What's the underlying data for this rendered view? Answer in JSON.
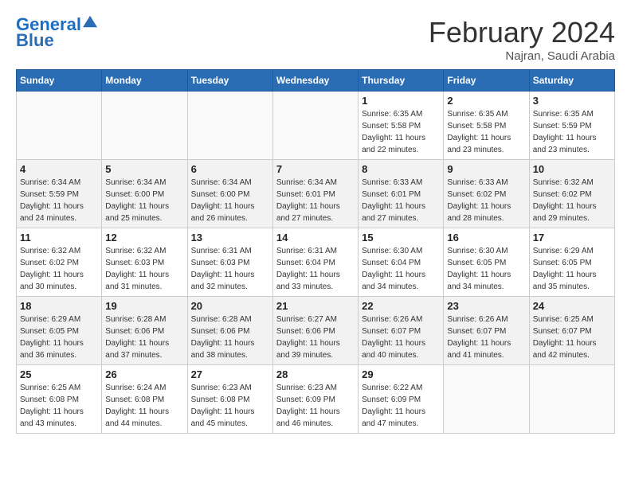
{
  "header": {
    "logo_line1": "General",
    "logo_line2": "Blue",
    "month": "February 2024",
    "location": "Najran, Saudi Arabia"
  },
  "days_of_week": [
    "Sunday",
    "Monday",
    "Tuesday",
    "Wednesday",
    "Thursday",
    "Friday",
    "Saturday"
  ],
  "weeks": [
    [
      {
        "day": "",
        "info": ""
      },
      {
        "day": "",
        "info": ""
      },
      {
        "day": "",
        "info": ""
      },
      {
        "day": "",
        "info": ""
      },
      {
        "day": "1",
        "info": "Sunrise: 6:35 AM\nSunset: 5:58 PM\nDaylight: 11 hours\nand 22 minutes."
      },
      {
        "day": "2",
        "info": "Sunrise: 6:35 AM\nSunset: 5:58 PM\nDaylight: 11 hours\nand 23 minutes."
      },
      {
        "day": "3",
        "info": "Sunrise: 6:35 AM\nSunset: 5:59 PM\nDaylight: 11 hours\nand 23 minutes."
      }
    ],
    [
      {
        "day": "4",
        "info": "Sunrise: 6:34 AM\nSunset: 5:59 PM\nDaylight: 11 hours\nand 24 minutes."
      },
      {
        "day": "5",
        "info": "Sunrise: 6:34 AM\nSunset: 6:00 PM\nDaylight: 11 hours\nand 25 minutes."
      },
      {
        "day": "6",
        "info": "Sunrise: 6:34 AM\nSunset: 6:00 PM\nDaylight: 11 hours\nand 26 minutes."
      },
      {
        "day": "7",
        "info": "Sunrise: 6:34 AM\nSunset: 6:01 PM\nDaylight: 11 hours\nand 27 minutes."
      },
      {
        "day": "8",
        "info": "Sunrise: 6:33 AM\nSunset: 6:01 PM\nDaylight: 11 hours\nand 27 minutes."
      },
      {
        "day": "9",
        "info": "Sunrise: 6:33 AM\nSunset: 6:02 PM\nDaylight: 11 hours\nand 28 minutes."
      },
      {
        "day": "10",
        "info": "Sunrise: 6:32 AM\nSunset: 6:02 PM\nDaylight: 11 hours\nand 29 minutes."
      }
    ],
    [
      {
        "day": "11",
        "info": "Sunrise: 6:32 AM\nSunset: 6:02 PM\nDaylight: 11 hours\nand 30 minutes."
      },
      {
        "day": "12",
        "info": "Sunrise: 6:32 AM\nSunset: 6:03 PM\nDaylight: 11 hours\nand 31 minutes."
      },
      {
        "day": "13",
        "info": "Sunrise: 6:31 AM\nSunset: 6:03 PM\nDaylight: 11 hours\nand 32 minutes."
      },
      {
        "day": "14",
        "info": "Sunrise: 6:31 AM\nSunset: 6:04 PM\nDaylight: 11 hours\nand 33 minutes."
      },
      {
        "day": "15",
        "info": "Sunrise: 6:30 AM\nSunset: 6:04 PM\nDaylight: 11 hours\nand 34 minutes."
      },
      {
        "day": "16",
        "info": "Sunrise: 6:30 AM\nSunset: 6:05 PM\nDaylight: 11 hours\nand 34 minutes."
      },
      {
        "day": "17",
        "info": "Sunrise: 6:29 AM\nSunset: 6:05 PM\nDaylight: 11 hours\nand 35 minutes."
      }
    ],
    [
      {
        "day": "18",
        "info": "Sunrise: 6:29 AM\nSunset: 6:05 PM\nDaylight: 11 hours\nand 36 minutes."
      },
      {
        "day": "19",
        "info": "Sunrise: 6:28 AM\nSunset: 6:06 PM\nDaylight: 11 hours\nand 37 minutes."
      },
      {
        "day": "20",
        "info": "Sunrise: 6:28 AM\nSunset: 6:06 PM\nDaylight: 11 hours\nand 38 minutes."
      },
      {
        "day": "21",
        "info": "Sunrise: 6:27 AM\nSunset: 6:06 PM\nDaylight: 11 hours\nand 39 minutes."
      },
      {
        "day": "22",
        "info": "Sunrise: 6:26 AM\nSunset: 6:07 PM\nDaylight: 11 hours\nand 40 minutes."
      },
      {
        "day": "23",
        "info": "Sunrise: 6:26 AM\nSunset: 6:07 PM\nDaylight: 11 hours\nand 41 minutes."
      },
      {
        "day": "24",
        "info": "Sunrise: 6:25 AM\nSunset: 6:07 PM\nDaylight: 11 hours\nand 42 minutes."
      }
    ],
    [
      {
        "day": "25",
        "info": "Sunrise: 6:25 AM\nSunset: 6:08 PM\nDaylight: 11 hours\nand 43 minutes."
      },
      {
        "day": "26",
        "info": "Sunrise: 6:24 AM\nSunset: 6:08 PM\nDaylight: 11 hours\nand 44 minutes."
      },
      {
        "day": "27",
        "info": "Sunrise: 6:23 AM\nSunset: 6:08 PM\nDaylight: 11 hours\nand 45 minutes."
      },
      {
        "day": "28",
        "info": "Sunrise: 6:23 AM\nSunset: 6:09 PM\nDaylight: 11 hours\nand 46 minutes."
      },
      {
        "day": "29",
        "info": "Sunrise: 6:22 AM\nSunset: 6:09 PM\nDaylight: 11 hours\nand 47 minutes."
      },
      {
        "day": "",
        "info": ""
      },
      {
        "day": "",
        "info": ""
      }
    ]
  ]
}
